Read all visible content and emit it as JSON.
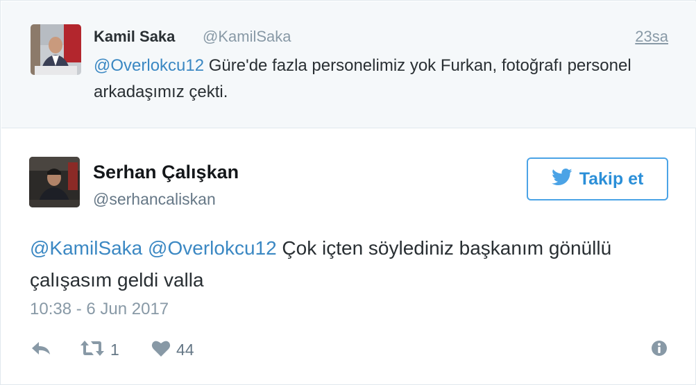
{
  "parent_tweet": {
    "name": "Kamil Saka",
    "handle": "@KamilSaka",
    "time": "23sa",
    "mention": "@Overlokcu12",
    "text": " Güre'de fazla personelimiz yok Furkan, fotoğrafı personel arkadaşımız çekti."
  },
  "main_tweet": {
    "name": "Serhan Çalışkan",
    "handle": "@serhancaliskan",
    "follow_label": "Takip et",
    "mention_1": "@KamilSaka",
    "space": " ",
    "mention_2": "@Overlokcu12",
    "text": " Çok içten söylediniz başkanım gönüllü çalışasım geldi valla",
    "date": "10:38 - 6 Jun 2017",
    "retweet_count": "1",
    "like_count": "44"
  },
  "colors": {
    "accent": "#3b88c3",
    "follow_border": "#4ba3e6",
    "muted": "#8899a6",
    "parent_bg": "#f5f8fa"
  },
  "icons": [
    "twitter-bird-icon",
    "reply-icon",
    "retweet-icon",
    "heart-icon",
    "info-icon"
  ]
}
